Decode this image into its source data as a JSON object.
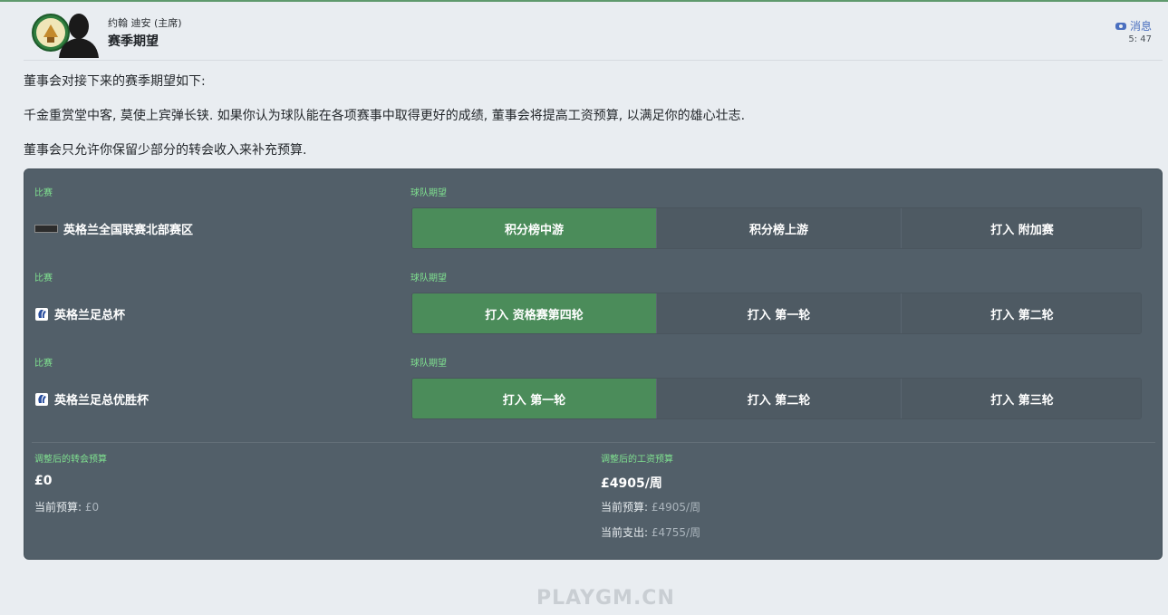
{
  "header": {
    "sender": "约翰 迪安 (主席)",
    "subject": "赛季期望",
    "inbox_label": "消息",
    "time": "5: 47"
  },
  "body": {
    "line1": "董事会对接下来的赛季期望如下:",
    "line2": "千金重赏堂中客, 莫使上宾弹长铗. 如果你认为球队能在各项赛事中取得更好的成绩, 董事会将提高工资预算, 以满足你的雄心壮志.",
    "line3": "董事会只允许你保留少部分的转会收入来补充预算."
  },
  "rows": [
    {
      "comp_label": "比赛",
      "exp_label": "球队期望",
      "competition": "英格兰全国联赛北部赛区",
      "icon": "league-logo",
      "options": [
        "积分榜中游",
        "积分榜上游",
        "打入 附加赛"
      ],
      "selected": 0
    },
    {
      "comp_label": "比赛",
      "exp_label": "球队期望",
      "competition": "英格兰足总杯",
      "icon": "fa-cup-logo",
      "options": [
        "打入 资格赛第四轮",
        "打入 第一轮",
        "打入 第二轮"
      ],
      "selected": 0
    },
    {
      "comp_label": "比赛",
      "exp_label": "球队期望",
      "competition": "英格兰足总优胜杯",
      "icon": "fa-trophy-logo",
      "options": [
        "打入 第一轮",
        "打入 第二轮",
        "打入 第三轮"
      ],
      "selected": 0
    }
  ],
  "budgets": {
    "transfer": {
      "label": "调整后的转会预算",
      "value": "£0",
      "current_key": "当前预算:",
      "current_val": "£0"
    },
    "wage": {
      "label": "调整后的工资预算",
      "value": "£4905/周",
      "current_key": "当前预算:",
      "current_val": "£4905/周",
      "spend_key": "当前支出:",
      "spend_val": "£4755/周"
    }
  },
  "watermark": "PLAYGM.CN",
  "colors": {
    "accent_green": "#4b8c5a",
    "label_green": "#7fe08f",
    "panel": "#525f69",
    "link_blue": "#4a6fbf"
  }
}
